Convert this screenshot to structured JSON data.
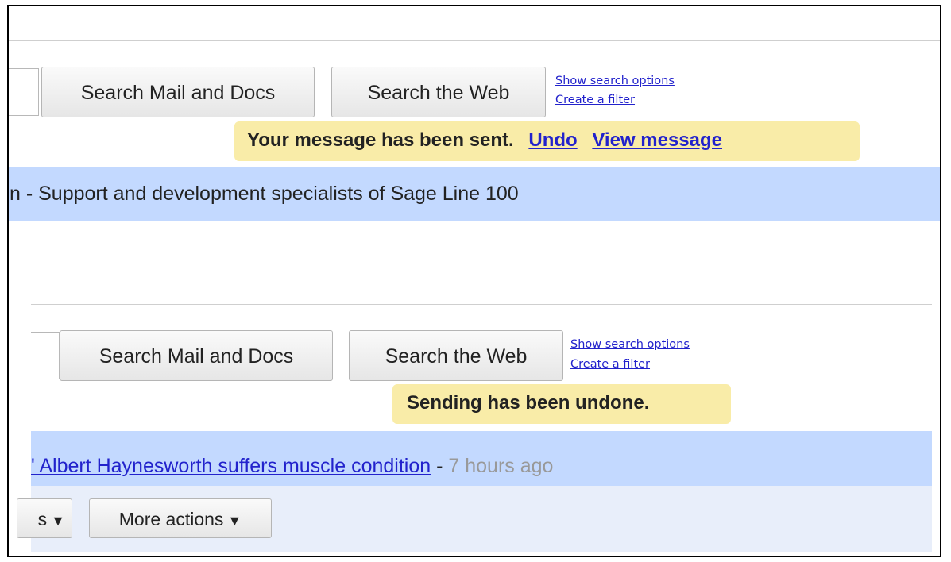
{
  "top_search": {
    "search_mail_button": "Search Mail and Docs",
    "search_web_button": "Search the Web",
    "show_options_link": "Show search options",
    "create_filter_link": "Create a filter"
  },
  "sent_notice": {
    "message": "Your message has been sent.",
    "undo_link": "Undo",
    "view_link": "View message"
  },
  "top_row": {
    "prefix": "n",
    "snippet": " - Support and development specialists of Sage Line 100"
  },
  "bottom_search": {
    "search_mail_button": "Search Mail and Docs",
    "search_web_button": "Search the Web",
    "show_options_link": "Show search options",
    "create_filter_link": "Create a filter"
  },
  "undone_notice": {
    "message": "Sending has been undone."
  },
  "bottom_row": {
    "link_text": "' Albert Haynesworth suffers muscle condition",
    "separator": " - ",
    "time": "7 hours ago"
  },
  "toolbar": {
    "partial_button_label": "s",
    "more_actions_label": "More actions",
    "dropdown_glyph": "▼"
  }
}
